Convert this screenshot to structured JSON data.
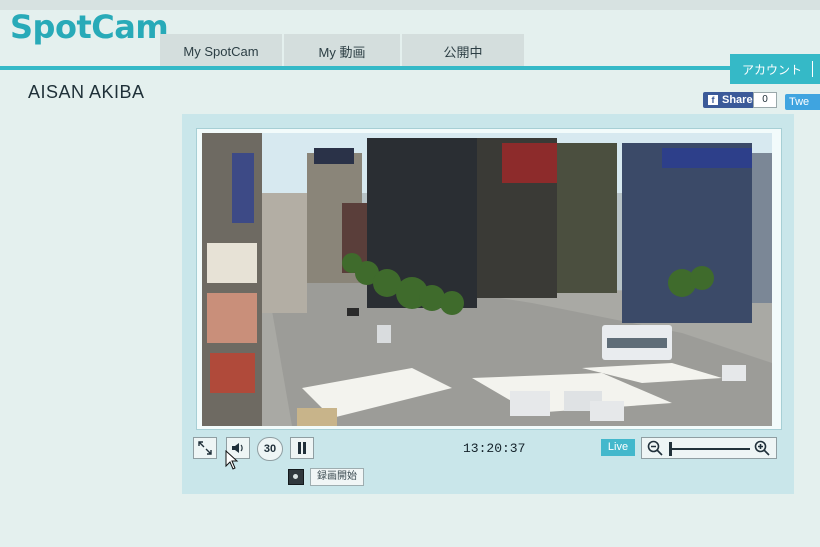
{
  "app": {
    "logo": "SpotCam"
  },
  "nav": {
    "tabs": [
      "My SpotCam",
      "My 動画",
      "公開中"
    ]
  },
  "account": {
    "label": "アカウント"
  },
  "page": {
    "title": "AISAN AKIBA"
  },
  "social": {
    "facebook_share": "Share",
    "share_count": "0",
    "tweet": "Twe"
  },
  "player": {
    "timecode": "13:20:37",
    "live_label": "Live",
    "rewind_label": "30",
    "record_label": "録画開始",
    "zoom_level": 0
  },
  "colors": {
    "accent": "#35b9c7",
    "facebook": "#3b5a99",
    "twitter": "#3fa4e0"
  },
  "icons": [
    "fullscreen-icon",
    "volume-icon",
    "rewind-30-icon",
    "pause-icon",
    "zoom-out-icon",
    "zoom-in-icon",
    "record-icon",
    "cursor-icon",
    "facebook-icon"
  ]
}
